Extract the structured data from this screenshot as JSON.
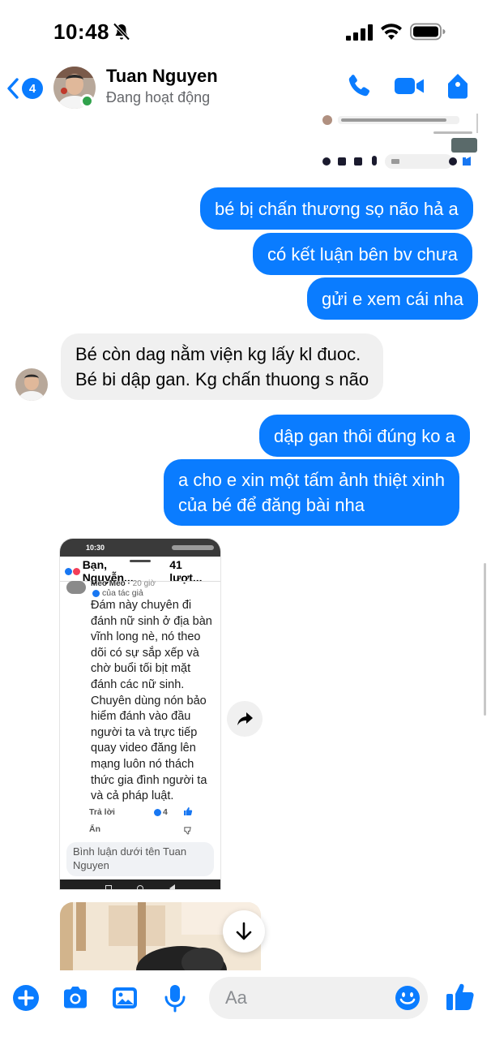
{
  "status_bar": {
    "time": "10:48"
  },
  "header": {
    "back_badge": "4",
    "contact_name": "Tuan Nguyen",
    "contact_status": "Đang hoạt động"
  },
  "messages": [
    {
      "direction": "outgoing",
      "text": "bé bị chấn thương sọ não hả a"
    },
    {
      "direction": "outgoing",
      "text": "có kết luận bên bv chưa"
    },
    {
      "direction": "outgoing",
      "text": "gửi e xem cái nha"
    },
    {
      "direction": "incoming",
      "lines": [
        "Bé còn dag nằm viện kg lấy kl đuoc.",
        "Bé bi dập gan. Kg chấn thuong s não"
      ]
    },
    {
      "direction": "outgoing",
      "text": "dập gan thôi đúng ko a"
    },
    {
      "direction": "outgoing",
      "lines": [
        "a cho e xin một tấm ảnh thiệt xinh",
        "của bé để đăng bài nha"
      ]
    }
  ],
  "shared_screenshot": {
    "status_time": "10:30",
    "head_title": "Bạn, Nguyễn...",
    "head_count": "41 lượt...",
    "author": "Meo Meo",
    "author_time": "20 giờ",
    "author_tag": "của tác giả",
    "body": "Đám này chuyên đi\nđánh nữ sinh ở địa bàn\nvĩnh long nè, nó theo\ndõi có sự sắp xếp và\nchờ buổi tối bịt mặt\nđánh các nữ sinh.\nChuyên dùng nón bảo\nhiểm đánh vào đầu\nngười ta và trực tiếp\nquay video đăng lên\nmạng luôn nó thách\nthức gia đình người ta\nvà cả pháp luật.",
    "reply_label": "Trả lời",
    "reaction_count": "4",
    "hide_label": "Ẩn",
    "comment_placeholder": "Bình luận dưới tên Tuan Nguyen"
  },
  "composer": {
    "placeholder": "Aa"
  },
  "colors": {
    "accent": "#0a7cff",
    "incoming_bubble": "#f0f0f0",
    "online": "#31a24c"
  }
}
